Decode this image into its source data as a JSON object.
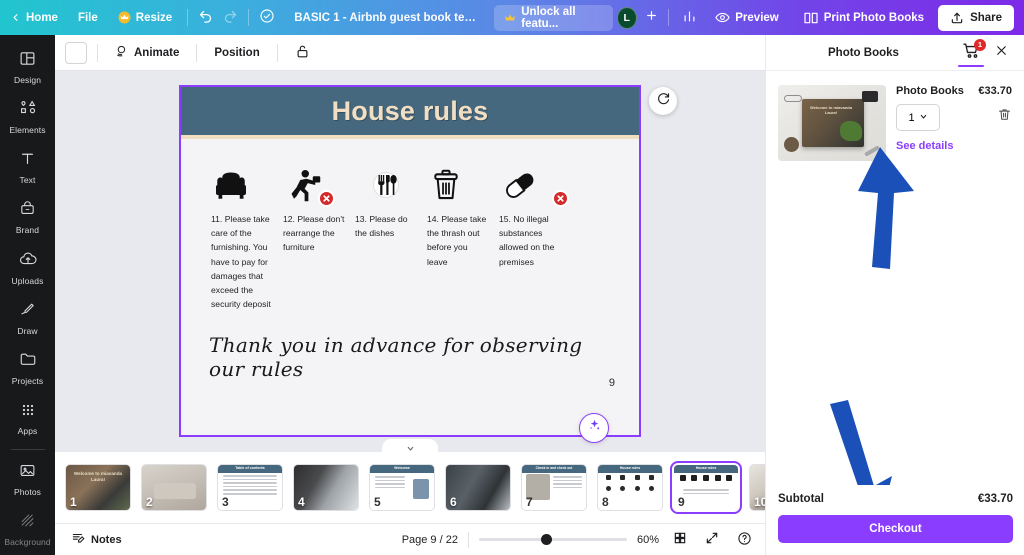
{
  "topbar": {
    "home_label": "Home",
    "file_label": "File",
    "resize_label": "Resize",
    "doc_title": "BASIC 1 - Airbnb guest book temp...",
    "unlock_label": "Unlock all featu...",
    "avatar_initial": "L",
    "preview_label": "Preview",
    "print_label": "Print Photo Books",
    "share_label": "Share",
    "icons": {
      "back": "chevron-left-icon",
      "resize": "crown-icon",
      "undo": "undo-icon",
      "redo": "redo-icon",
      "cloud": "cloud-saved-icon",
      "stats": "insights-icon",
      "eye": "eye-icon",
      "book": "book-icon",
      "share": "share-upload-icon",
      "add_member": "plus-icon"
    }
  },
  "rail": {
    "items": [
      {
        "label": "Design",
        "icon": "design-icon"
      },
      {
        "label": "Elements",
        "icon": "elements-icon"
      },
      {
        "label": "Text",
        "icon": "text-icon"
      },
      {
        "label": "Brand",
        "icon": "brand-icon"
      },
      {
        "label": "Uploads",
        "icon": "uploads-icon"
      },
      {
        "label": "Draw",
        "icon": "draw-icon"
      },
      {
        "label": "Projects",
        "icon": "projects-icon"
      },
      {
        "label": "Apps",
        "icon": "apps-icon"
      },
      {
        "label": "Photos",
        "icon": "photos-icon"
      },
      {
        "label": "Background",
        "icon": "background-icon"
      }
    ]
  },
  "editor_toolbar": {
    "animate_label": "Animate",
    "position_label": "Position",
    "lock_icon": "unlock-icon",
    "color_swatch": "#ffffff"
  },
  "canvas": {
    "page_title": "House rules",
    "header_bg": "#45687f",
    "header_text_color": "#f2dfc3",
    "header_border": "#f0ddc2",
    "page_bg": "#f4f4f6",
    "selection_color": "#8b3dff",
    "rules": [
      {
        "icon": "armchair-icon",
        "blocked": false,
        "text": "11. Please take care of the furnishing. You have to pay for damages that exceed the security deposit"
      },
      {
        "icon": "pushing-furniture-icon",
        "blocked": true,
        "text": "12. Please don't rearrange the furniture"
      },
      {
        "icon": "cutlery-icon",
        "blocked": false,
        "text": "13. Please do the dishes"
      },
      {
        "icon": "trash-bin-icon",
        "blocked": false,
        "text": "14. Please take the thrash out before you leave"
      },
      {
        "icon": "pill-capsule-icon",
        "blocked": true,
        "text": "15. No illegal substances allowed on the premises"
      }
    ],
    "thanks_text": "Thank you in advance for observing our rules",
    "page_number": "9",
    "rotate_icon": "rotate-icon",
    "magic_icon": "magic-sparkle-icon"
  },
  "thumbnails": {
    "pages": [
      {
        "number": "1",
        "kind": "photo-cover",
        "title": "Welcome to miavanda Laura!"
      },
      {
        "number": "2",
        "kind": "photo"
      },
      {
        "number": "3",
        "kind": "doc",
        "title": "Table of contents"
      },
      {
        "number": "4",
        "kind": "photo"
      },
      {
        "number": "5",
        "kind": "doc",
        "title": "Welcome"
      },
      {
        "number": "6",
        "kind": "photo"
      },
      {
        "number": "7",
        "kind": "doc",
        "title": "Check in and check out"
      },
      {
        "number": "8",
        "kind": "doc",
        "title": "House rules"
      },
      {
        "number": "9",
        "kind": "doc",
        "title": "House rules",
        "selected": true
      },
      {
        "number": "10",
        "kind": "photo"
      }
    ]
  },
  "statusbar": {
    "notes_label": "Notes",
    "page_indicator": "Page 9 / 22",
    "zoom_level": "60%",
    "grid_icon": "grid-view-icon",
    "expand_icon": "fullscreen-icon",
    "help_icon": "help-icon",
    "notes_icon": "notes-icon"
  },
  "right_panel": {
    "title": "Photo Books",
    "cart_icon": "shopping-cart-icon",
    "cart_badge": "1",
    "close_icon": "close-icon",
    "item": {
      "name": "Photo Books",
      "price": "€33.70",
      "quantity": "1",
      "see_details_label": "See details",
      "delete_icon": "trash-icon",
      "chevron_icon": "chevron-down-icon",
      "thumbnail_alt": "photo-book-mockup"
    },
    "subtotal_label": "Subtotal",
    "subtotal_value": "€33.70",
    "checkout_label": "Checkout",
    "accent_color": "#8b3dff",
    "annotation_arrow_color": "#1a50b8"
  }
}
